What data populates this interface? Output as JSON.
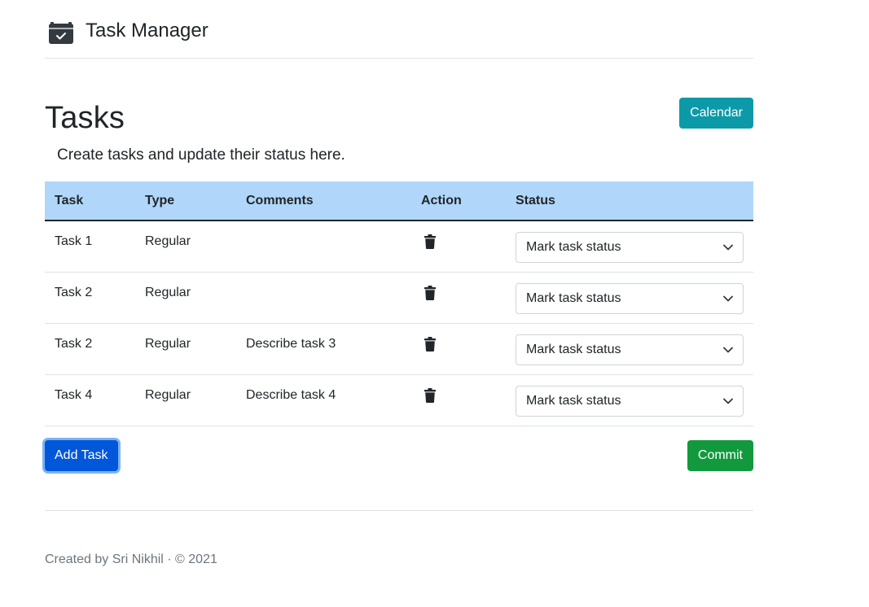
{
  "header": {
    "title": "Task Manager",
    "logo_icon": "calendar-check-icon"
  },
  "main": {
    "title": "Tasks",
    "subtitle": "Create tasks and update their status here.",
    "calendar_button": "Calendar"
  },
  "table": {
    "columns": [
      "Task",
      "Type",
      "Comments",
      "Action",
      "Status"
    ],
    "rows": [
      {
        "task": "Task 1",
        "type": "Regular",
        "comments": "",
        "action_icon": "trash-icon",
        "status": "Mark task status"
      },
      {
        "task": "Task 2",
        "type": "Regular",
        "comments": "",
        "action_icon": "trash-icon",
        "status": "Mark task status"
      },
      {
        "task": "Task 2",
        "type": "Regular",
        "comments": "Describe task 3",
        "action_icon": "trash-icon",
        "status": "Mark task status"
      },
      {
        "task": "Task 4",
        "type": "Regular",
        "comments": "Describe task 4",
        "action_icon": "trash-icon",
        "status": "Mark task status"
      }
    ]
  },
  "actions": {
    "add_task": "Add Task",
    "commit": "Commit"
  },
  "footer": {
    "text": "Created by Sri Nikhil · © 2021"
  },
  "colors": {
    "table_header_bg": "#b0d7fa",
    "calendar_button": "#0d9aa8",
    "add_task_button": "#0057d9",
    "commit_button": "#12993e"
  }
}
